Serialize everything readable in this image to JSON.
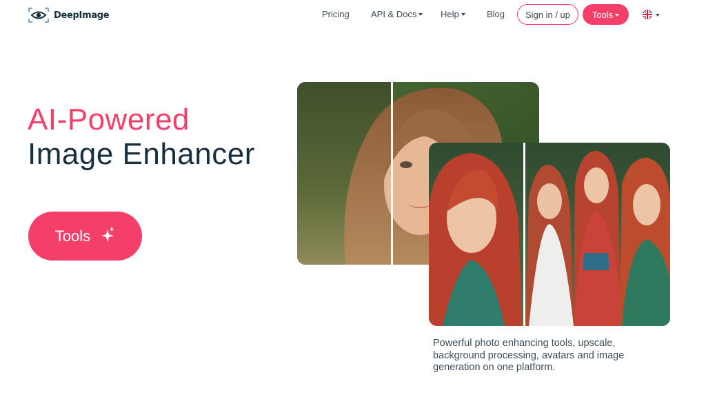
{
  "brand": {
    "name": "DeepImage"
  },
  "nav": {
    "pricing": "Pricing",
    "api_docs": "API & Docs",
    "help": "Help",
    "blog": "Blog",
    "signin": "Sign in / up",
    "tools": "Tools"
  },
  "hero": {
    "title_line1": "AI-Powered",
    "title_line2": "Image Enhancer",
    "cta_label": "Tools",
    "description": "Powerful photo enhancing tools, upscale, background processing, avatars and image generation on one platform."
  },
  "colors": {
    "accent": "#f43f6a",
    "heading": "#16303f",
    "body_text": "#3c4b57"
  },
  "icons": [
    "eye-logo-icon",
    "caret-down-icon",
    "uk-flag-icon",
    "sparkle-icon",
    "compare-divider"
  ]
}
